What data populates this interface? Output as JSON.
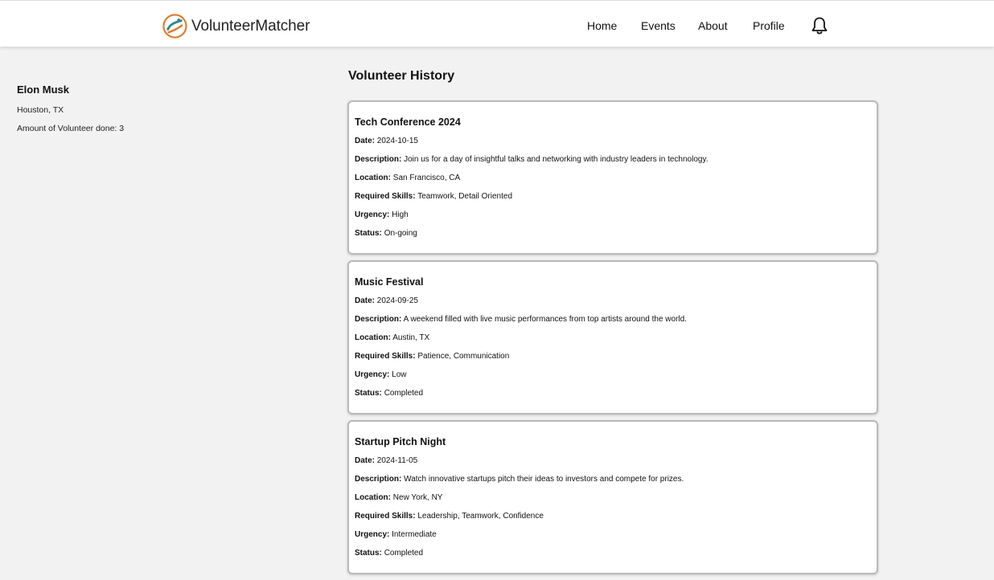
{
  "app": {
    "brand": "VolunteerMatcher",
    "brand_colors": {
      "orange": "#e07a2e",
      "teal": "#2a8a8c"
    }
  },
  "nav": {
    "links": [
      {
        "label": "Home"
      },
      {
        "label": "Events"
      },
      {
        "label": "About"
      },
      {
        "label": "Profile"
      }
    ],
    "notification_icon": "bell-icon"
  },
  "profile": {
    "name": "Elon Musk",
    "location": "Houston, TX",
    "volunteer_count_text": "Amount of Volunteer done: 3"
  },
  "history": {
    "title": "Volunteer History",
    "labels": {
      "date": "Date:",
      "description": "Description:",
      "location": "Location:",
      "skills": "Required Skills:",
      "urgency": "Urgency:",
      "status": "Status:"
    },
    "events": [
      {
        "title": "Tech Conference 2024",
        "date": "2024-10-15",
        "description": "Join us for a day of insightful talks and networking with industry leaders in technology.",
        "location": "San Francisco, CA",
        "skills": "Teamwork, Detail Oriented",
        "urgency": "High",
        "status": "On-going"
      },
      {
        "title": "Music Festival",
        "date": "2024-09-25",
        "description": "A weekend filled with live music performances from top artists around the world.",
        "location": "Austin, TX",
        "skills": "Patience, Communication",
        "urgency": "Low",
        "status": "Completed"
      },
      {
        "title": "Startup Pitch Night",
        "date": "2024-11-05",
        "description": "Watch innovative startups pitch their ideas to investors and compete for prizes.",
        "location": "New York, NY",
        "skills": "Leadership, Teamwork, Confidence",
        "urgency": "Intermediate",
        "status": "Completed"
      }
    ]
  }
}
